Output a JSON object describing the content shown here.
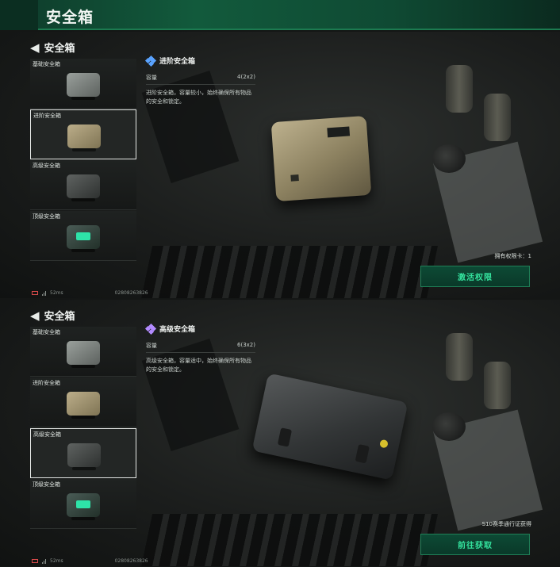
{
  "app": {
    "title": "安全箱"
  },
  "panels": [
    {
      "header": {
        "title": "安全箱"
      },
      "items": [
        {
          "label": "基础安全箱",
          "selected": false,
          "color": "gray"
        },
        {
          "label": "进阶安全箱",
          "selected": true,
          "color": "tan"
        },
        {
          "label": "高级安全箱",
          "selected": false,
          "color": "dark"
        },
        {
          "label": "顶级安全箱",
          "selected": false,
          "color": "teal"
        }
      ],
      "detail": {
        "name": "进阶安全箱",
        "tier_icon": "blue-diamond-icon",
        "capacity_label": "容量",
        "capacity_value": "4(2x2)",
        "description": "进阶安全箱，容量较小，始终确保所有物品的安全和锁定。"
      },
      "note": "拥有权限卡：1",
      "action_label": "激活权限",
      "status": {
        "ping": "52ms",
        "code": "02808263826"
      }
    },
    {
      "header": {
        "title": "安全箱"
      },
      "items": [
        {
          "label": "基础安全箱",
          "selected": false,
          "color": "gray"
        },
        {
          "label": "进阶安全箱",
          "selected": false,
          "color": "tan"
        },
        {
          "label": "高级安全箱",
          "selected": true,
          "color": "dark"
        },
        {
          "label": "顶级安全箱",
          "selected": false,
          "color": "teal"
        }
      ],
      "detail": {
        "name": "高级安全箱",
        "tier_icon": "purple-diamond-icon",
        "capacity_label": "容量",
        "capacity_value": "6(3x2)",
        "description": "高级安全箱，容量适中，始终确保所有物品的安全和锁定。"
      },
      "note": "S10赛季通行证获得",
      "action_label": "前往获取",
      "status": {
        "ping": "52ms",
        "code": "02808263826"
      }
    }
  ],
  "colors": {
    "accent_green": "#34e39e",
    "topbar": "#125a3c",
    "selection_border": "#e6e9e7"
  }
}
